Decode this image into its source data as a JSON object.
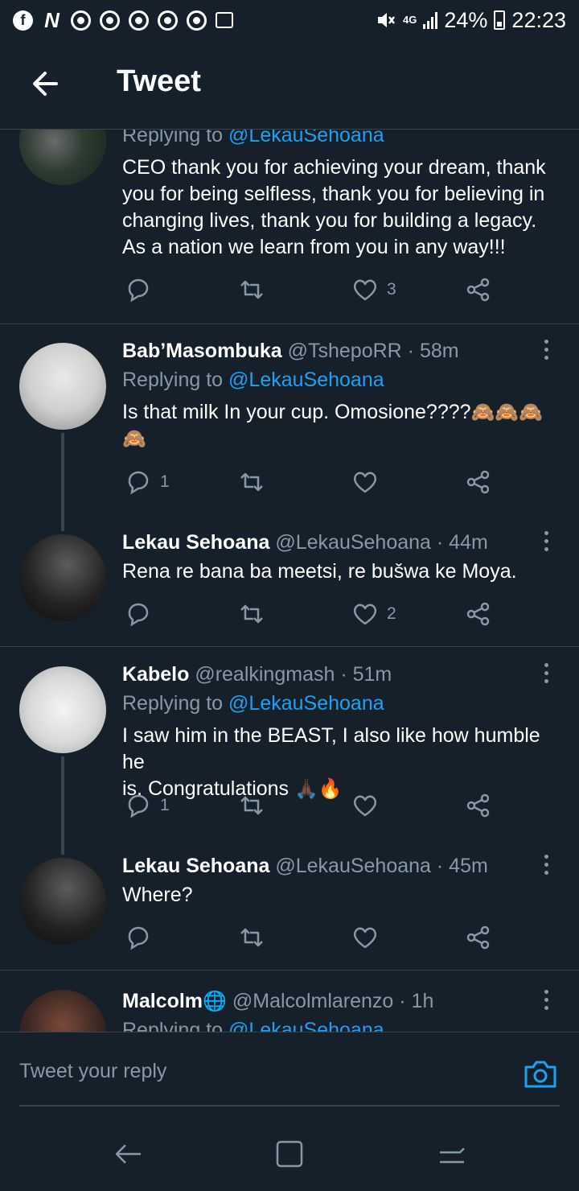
{
  "status_bar": {
    "battery": "24%",
    "time": "22:23",
    "network": "4G",
    "icons": [
      "facebook-icon",
      "n-app-icon",
      "chrome-icon",
      "chrome-icon",
      "chrome-icon",
      "chrome-icon",
      "chrome-icon",
      "gallery-icon",
      "mute-icon",
      "signal-icon",
      "battery-icon"
    ]
  },
  "header": {
    "title": "Tweet"
  },
  "tweets": [
    {
      "replying_to_prefix": "Replying to",
      "replying_to_handle": "@LekauSehoana",
      "text": "CEO thank you for achieving your dream, thank you for being selfless, thank you for believing in changing lives, thank you for building a legacy. As a nation we learn from you in any way!!!",
      "replies": "",
      "likes": "3"
    },
    {
      "name": "Bab’Masombuka",
      "handle": "@TshepoRR",
      "time": "· 58m",
      "replying_to_prefix": "Replying to",
      "replying_to_handle": "@LekauSehoana",
      "text": "Is that milk In your cup. Omosione????",
      "emoji_line": "🙈🙈🙈",
      "emoji_line2": "🙈",
      "replies": "1",
      "likes": ""
    },
    {
      "name": "Lekau Sehoana",
      "handle": "@LekauSehoana",
      "time": "· 44m",
      "text": "Rena re bana ba meetsi, re bušwa ke Moya.",
      "replies": "",
      "likes": "2"
    },
    {
      "name": "Kabelo",
      "handle": "@realkingmash",
      "time": "· 51m",
      "replying_to_prefix": "Replying to",
      "replying_to_handle": "@LekauSehoana",
      "text_line1": "I saw him in the BEAST, I also like how humble he",
      "text_line2": "is. Congratulations",
      "emoji": "🙏🏿🔥",
      "replies": "1",
      "likes": ""
    },
    {
      "name": "Lekau Sehoana",
      "handle": "@LekauSehoana",
      "time": "· 45m",
      "text": "Where?",
      "replies": "",
      "likes": ""
    },
    {
      "name": "Malcolm",
      "name_emoji": "🌐",
      "handle": "@Malcolmlarenzo",
      "time": "· 1h",
      "replying_to_prefix": "Replying to",
      "replying_to_handle": "@LekauSehoana"
    }
  ],
  "composer": {
    "placeholder": "Tweet your reply"
  },
  "colors": {
    "background": "#15202b",
    "accent": "#1da1f2",
    "secondary_text": "#8899a6",
    "divider": "#38444d"
  }
}
